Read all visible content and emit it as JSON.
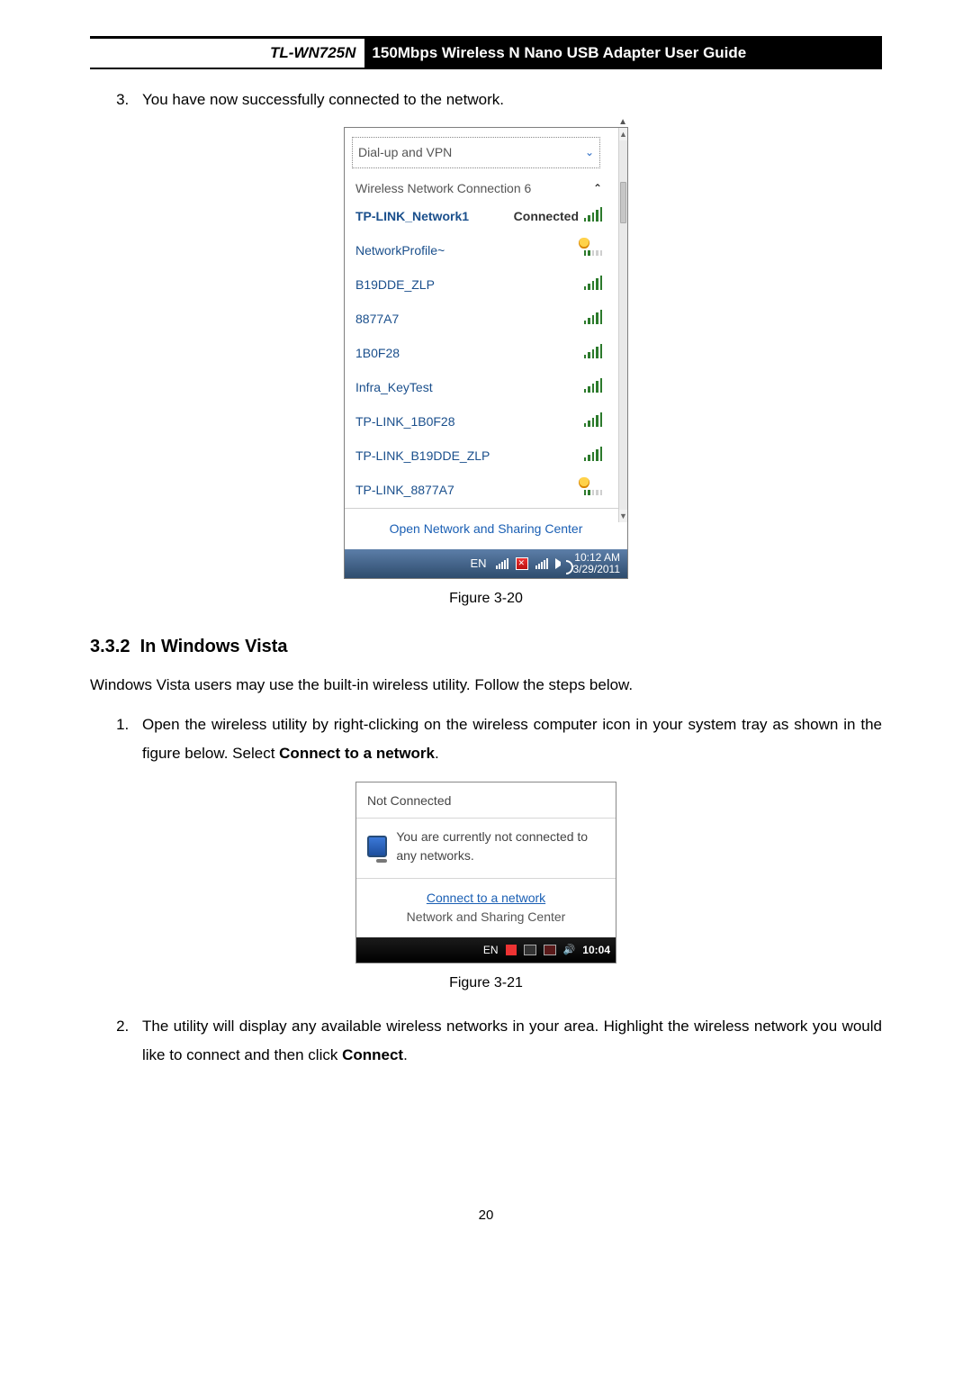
{
  "header": {
    "model": "TL-WN725N",
    "title": "150Mbps Wireless N Nano USB Adapter User Guide"
  },
  "step3": {
    "num": "3.",
    "text": "You have now successfully connected to the network."
  },
  "fig20": {
    "caption": "Figure 3-20",
    "dialup_label": "Dial-up and VPN",
    "conn_header": "Wireless Network Connection 6",
    "open_link": "Open Network and Sharing Center",
    "networks": [
      {
        "name": "TP-LINK_Network1",
        "status": "Connected",
        "bold": true,
        "shield": false,
        "weak": false
      },
      {
        "name": "NetworkProfile~",
        "status": "",
        "bold": false,
        "shield": true,
        "weak": true
      },
      {
        "name": "B19DDE_ZLP",
        "status": "",
        "bold": false,
        "shield": false,
        "weak": false
      },
      {
        "name": "8877A7",
        "status": "",
        "bold": false,
        "shield": false,
        "weak": false
      },
      {
        "name": "1B0F28",
        "status": "",
        "bold": false,
        "shield": false,
        "weak": false
      },
      {
        "name": "Infra_KeyTest",
        "status": "",
        "bold": false,
        "shield": false,
        "weak": false
      },
      {
        "name": "TP-LINK_1B0F28",
        "status": "",
        "bold": false,
        "shield": false,
        "weak": false
      },
      {
        "name": "TP-LINK_B19DDE_ZLP",
        "status": "",
        "bold": false,
        "shield": false,
        "weak": false
      },
      {
        "name": "TP-LINK_8877A7",
        "status": "",
        "bold": false,
        "shield": true,
        "weak": true
      }
    ],
    "taskbar": {
      "lang": "EN",
      "time": "10:12 AM",
      "date": "3/29/2011"
    }
  },
  "section": {
    "num": "3.3.2",
    "title": "In Windows Vista"
  },
  "vista_intro": "Windows Vista users may use the built-in wireless utility. Follow the steps below.",
  "step1": {
    "num": "1.",
    "text_a": "Open the wireless utility by right-clicking on the wireless computer icon in your system tray as shown in the figure below. Select ",
    "bold": "Connect to a network",
    "text_b": "."
  },
  "fig21": {
    "caption": "Figure 3-21",
    "top": "Not Connected",
    "msg": "You are currently not connected to any networks.",
    "link1": "Connect to a network",
    "link2": "Network and Sharing Center",
    "taskbar": {
      "lang": "EN",
      "time": "10:04"
    }
  },
  "step2": {
    "num": "2.",
    "text_a": "The utility will display any available wireless networks in your area. Highlight the wireless network you would like to connect and then click ",
    "bold": "Connect",
    "text_b": "."
  },
  "page_number": "20"
}
